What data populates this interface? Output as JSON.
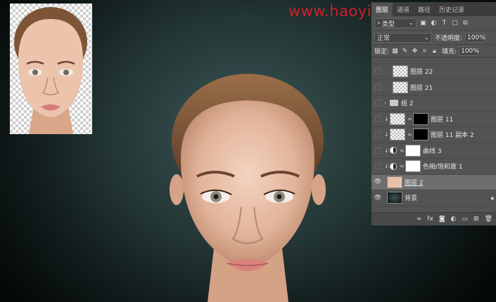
{
  "watermark": "www.haoyinfalian.com",
  "panel": {
    "tabs": [
      {
        "label": "图层",
        "active": true
      },
      {
        "label": "通道",
        "active": false
      },
      {
        "label": "路径",
        "active": false
      },
      {
        "label": "历史记录",
        "active": false
      }
    ],
    "filter": {
      "label": "类型"
    },
    "blend_mode": "正常",
    "opacity_label": "不透明度:",
    "opacity_value": "100%",
    "lock_label": "锁定:",
    "fill_label": "填充:",
    "fill_value": "100%",
    "layers": [
      {
        "name": "图层 22",
        "kind": "pixel",
        "visible": false
      },
      {
        "name": "图层 21",
        "kind": "pixel",
        "visible": false
      },
      {
        "name": "组 2",
        "kind": "group",
        "visible": false
      },
      {
        "name": "图层 11",
        "kind": "pixel-mask",
        "visible": false
      },
      {
        "name": "图层 11 副本 2",
        "kind": "pixel-mask",
        "visible": false
      },
      {
        "name": "曲线 3",
        "kind": "adjustment",
        "visible": false
      },
      {
        "name": "色相/饱和度 1",
        "kind": "adjustment",
        "visible": false
      },
      {
        "name": "图层 2",
        "kind": "photo",
        "visible": true,
        "selected": true
      },
      {
        "name": "背景",
        "kind": "background",
        "visible": true
      }
    ],
    "bottom_icons": [
      "link-icon",
      "fx-icon",
      "mask-icon",
      "adjustment-icon",
      "folder-icon",
      "new-layer-icon",
      "trash-icon"
    ],
    "bottom_fx": "fx"
  }
}
